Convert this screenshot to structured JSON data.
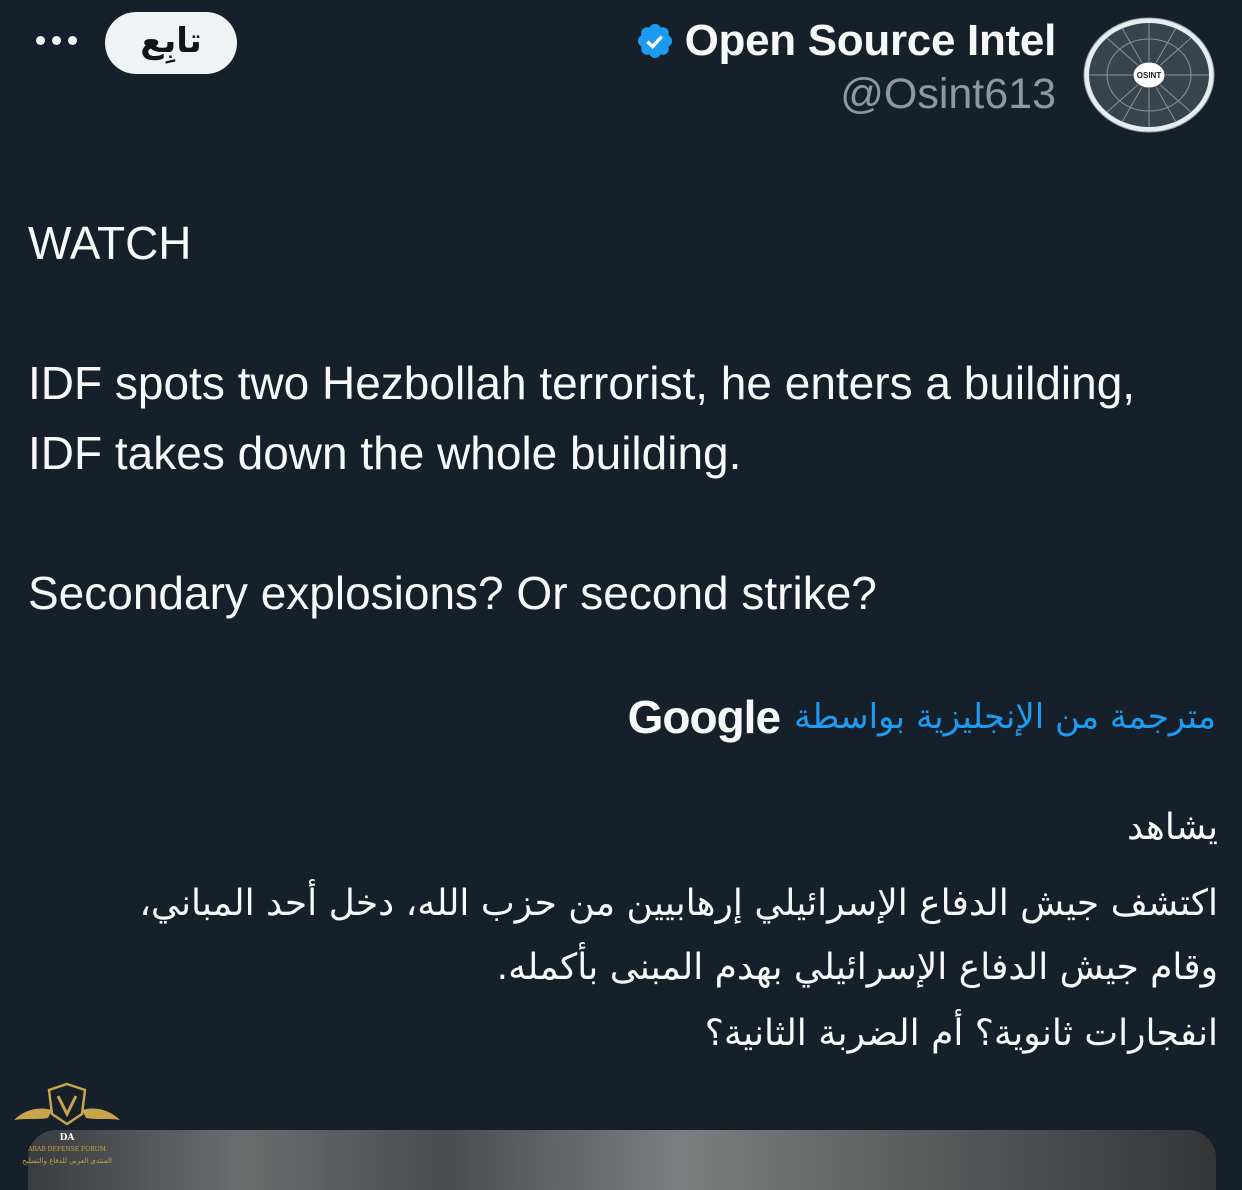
{
  "header": {
    "more_label": "•••",
    "follow_label": "تابِع",
    "display_name": "Open Source Intel",
    "handle": "@Osint613",
    "verified": true,
    "avatar_text": "OSINT"
  },
  "tweet": {
    "paragraphs": [
      "WATCH",
      "IDF spots two Hezbollah terrorist, he enters a building, IDF takes down the whole building.",
      "Secondary explosions? Or second strike?"
    ]
  },
  "translation": {
    "label": "مترجمة من الإنجليزية بواسطة",
    "provider": "Google",
    "paragraphs": [
      "يشاهد",
      "اكتشف جيش الدفاع الإسرائيلي إرهابيين من حزب الله، دخل أحد المباني، وقام جيش الدفاع الإسرائيلي بهدم المبنى بأكمله.",
      "انفجارات ثانوية؟ أم الضربة الثانية؟"
    ]
  },
  "watermark": {
    "line1": "ARAB DEFENSE FORUM",
    "line2": "المنتدى العربي للدفاع والتسليح",
    "monogram": "DA"
  },
  "colors": {
    "background": "#15202b",
    "text": "#f7f9f9",
    "muted": "#8b98a5",
    "accent": "#1d9bf0",
    "follow_bg": "#eff3f4",
    "watermark_gold": "#c9a44a"
  }
}
